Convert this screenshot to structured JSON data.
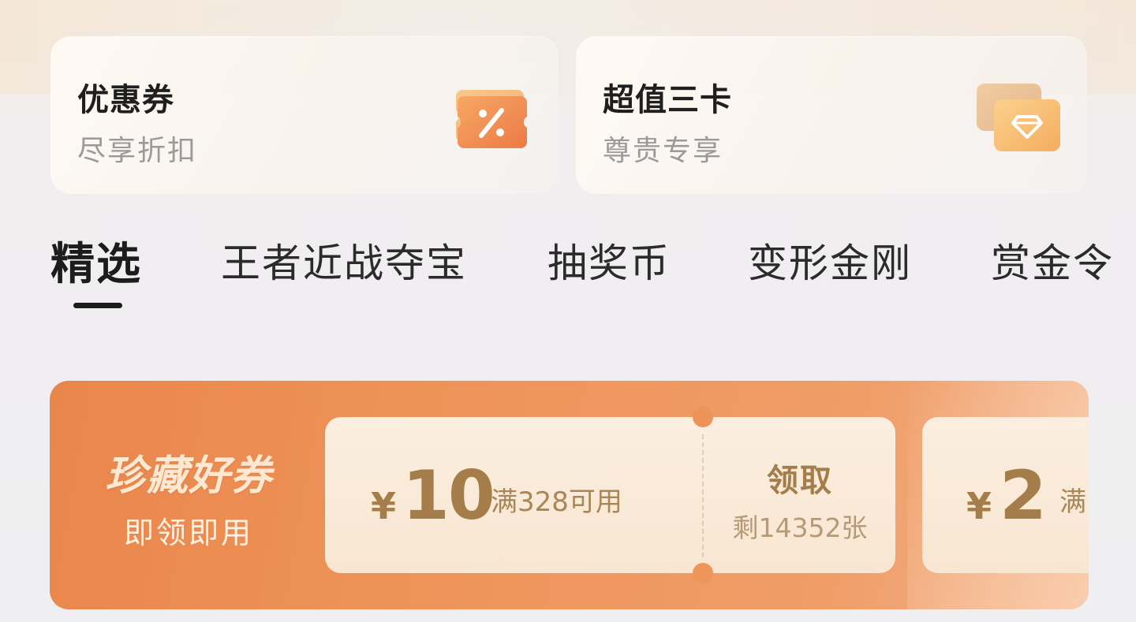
{
  "cards": [
    {
      "title": "优惠券",
      "subtitle": "尽享折扣",
      "icon": "coupon-percent-icon"
    },
    {
      "title": "超值三卡",
      "subtitle": "尊贵专享",
      "icon": "diamond-cards-icon"
    }
  ],
  "tabs": [
    {
      "label": "精选",
      "active": true
    },
    {
      "label": "王者近战夺宝",
      "active": false
    },
    {
      "label": "抽奖币",
      "active": false
    },
    {
      "label": "变形金刚",
      "active": false
    },
    {
      "label": "赏金令",
      "active": false
    }
  ],
  "banner": {
    "title": "珍藏好券",
    "subtitle": "即领即用",
    "coupons": [
      {
        "currency": "¥",
        "amount": "10",
        "condition": "满328可用",
        "claim_label": "领取",
        "remaining": "剩14352张"
      },
      {
        "currency": "¥",
        "amount": "2",
        "condition": "满"
      }
    ]
  },
  "colors": {
    "accent_orange": "#ee9358",
    "coupon_text": "#a57d4a",
    "coupon_bg": "#fbeee0"
  }
}
